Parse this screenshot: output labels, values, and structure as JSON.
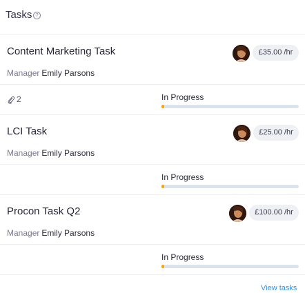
{
  "header": {
    "title": "Tasks",
    "help_icon": "question-circle-icon",
    "help_glyph": "?"
  },
  "tasks": [
    {
      "name": "Content Marketing Task",
      "manager_label": "Manager",
      "manager_name": "Emily Parsons",
      "rate": "£35.00 /hr",
      "attachments": "2",
      "status": "In Progress",
      "progress": 0.02
    },
    {
      "name": "LCI Task",
      "manager_label": "Manager",
      "manager_name": "Emily Parsons",
      "rate": "£25.00 /hr",
      "status": "In Progress",
      "progress": 0.02
    },
    {
      "name": "Procon Task Q2",
      "manager_label": "Manager",
      "manager_name": "Emily Parsons",
      "rate": "£100.00 /hr",
      "status": "In Progress",
      "progress": 0.02
    }
  ],
  "footer": {
    "view_tasks": "View tasks"
  },
  "colors": {
    "accent": "#3b8fd0",
    "progress": "#f2a516",
    "track": "#dde3ea"
  }
}
